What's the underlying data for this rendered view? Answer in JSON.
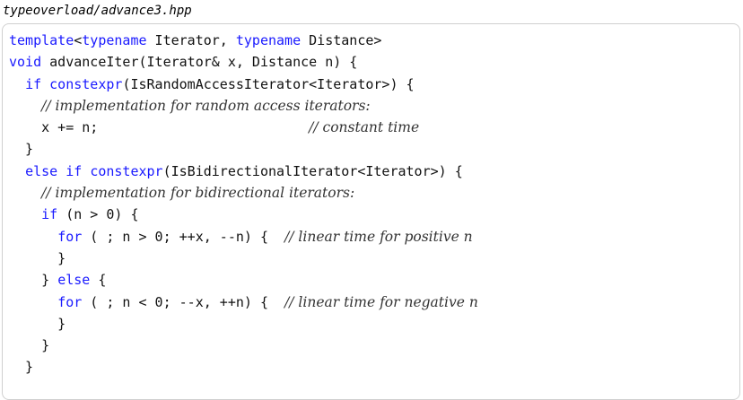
{
  "file": {
    "name": "typeoverload/advance3.hpp"
  },
  "lines": [
    [
      {
        "t": "template",
        "k": "kw"
      },
      {
        "t": "<"
      },
      {
        "t": "typename",
        "k": "kw"
      },
      {
        "t": " Iterator, "
      },
      {
        "t": "typename",
        "k": "kw"
      },
      {
        "t": " Distance>"
      }
    ],
    [
      {
        "t": "void",
        "k": "kw"
      },
      {
        "t": " advanceIter(Iterator& x, Distance n) {"
      }
    ],
    [
      {
        "t": "  "
      },
      {
        "t": "if",
        "k": "kw"
      },
      {
        "t": " "
      },
      {
        "t": "constexpr",
        "k": "kw"
      },
      {
        "t": "(IsRandomAccessIterator<Iterator>) {"
      }
    ],
    [
      {
        "t": "    "
      },
      {
        "t": "// implementation for random access iterators:",
        "k": "cmt"
      }
    ],
    [
      {
        "t": "    x += n;                          "
      },
      {
        "t": "// constant time",
        "k": "cmt"
      }
    ],
    [
      {
        "t": "  }"
      }
    ],
    [
      {
        "t": "  "
      },
      {
        "t": "else",
        "k": "kw"
      },
      {
        "t": " "
      },
      {
        "t": "if",
        "k": "kw"
      },
      {
        "t": " "
      },
      {
        "t": "constexpr",
        "k": "kw"
      },
      {
        "t": "(IsBidirectionalIterator<Iterator>) {"
      }
    ],
    [
      {
        "t": "    "
      },
      {
        "t": "// implementation for bidirectional iterators:",
        "k": "cmt"
      }
    ],
    [
      {
        "t": "    "
      },
      {
        "t": "if",
        "k": "kw"
      },
      {
        "t": " (n > 0) {"
      }
    ],
    [
      {
        "t": "      "
      },
      {
        "t": "for",
        "k": "kw"
      },
      {
        "t": " ( ; n > 0; ++x, --n) {  "
      },
      {
        "t": "// linear time for positive n",
        "k": "cmt"
      }
    ],
    [
      {
        "t": "      }"
      }
    ],
    [
      {
        "t": "    } "
      },
      {
        "t": "else",
        "k": "kw"
      },
      {
        "t": " {"
      }
    ],
    [
      {
        "t": "      "
      },
      {
        "t": "for",
        "k": "kw"
      },
      {
        "t": " ( ; n < 0; --x, ++n) {  "
      },
      {
        "t": "// linear time for negative n",
        "k": "cmt"
      }
    ],
    [
      {
        "t": "      }"
      }
    ],
    [
      {
        "t": "    }"
      }
    ],
    [
      {
        "t": "  }"
      }
    ]
  ]
}
